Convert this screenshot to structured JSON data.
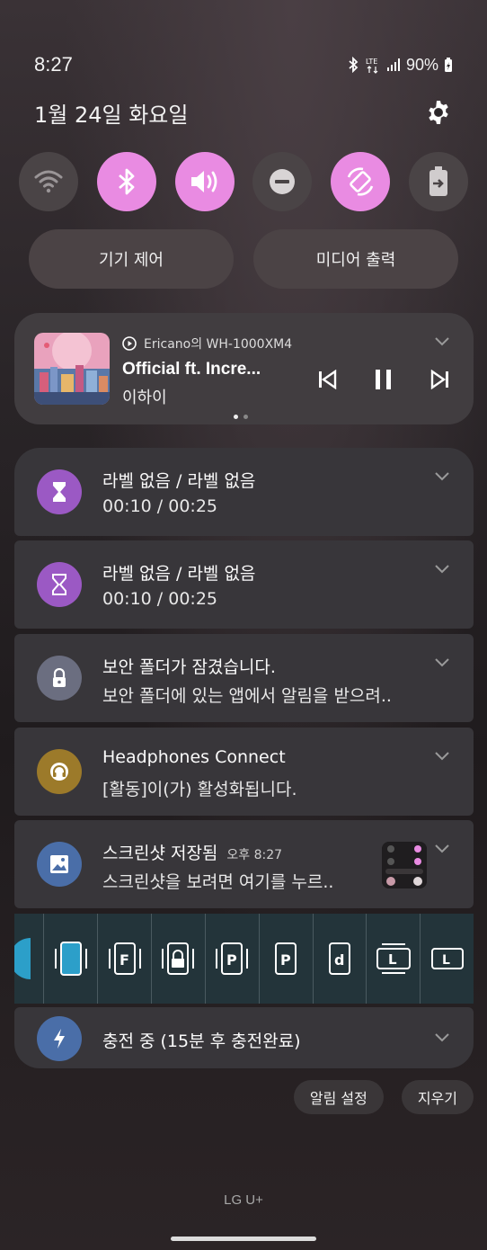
{
  "status_bar": {
    "time": "8:27",
    "network": "LTE",
    "battery": "90%"
  },
  "header": {
    "date": "1월 24일 화요일"
  },
  "quick_toggles": [
    {
      "name": "wifi",
      "on": false
    },
    {
      "name": "bluetooth",
      "on": true
    },
    {
      "name": "sound",
      "on": true
    },
    {
      "name": "do-not-disturb",
      "on": false
    },
    {
      "name": "auto-rotate",
      "on": true
    },
    {
      "name": "power-share",
      "on": false
    }
  ],
  "pills": {
    "device_control": "기기 제어",
    "media_output": "미디어 출력"
  },
  "media": {
    "source": "Ericano의 WH-1000XM4",
    "title": "Official ft. Incre...",
    "artist": "이하이"
  },
  "notifications": [
    {
      "title": "라벨 없음 / 라벨 없음",
      "sub": "00:10 / 00:25",
      "icon": "hourglass-icon",
      "color": "#9b59c4"
    },
    {
      "title": "라벨 없음 / 라벨 없음",
      "sub": "00:10 / 00:25",
      "icon": "hourglass-outline-icon",
      "color": "#9b59c4"
    },
    {
      "title": "보안 폴더가 잠겼습니다.",
      "sub": "보안 폴더에 있는 앱에서 알림을 받으려..",
      "icon": "lock-icon",
      "color": "#6b6e80"
    },
    {
      "title": "Headphones Connect",
      "sub": "[활동]이(가) 활성화됩니다.",
      "icon": "headphones-icon",
      "color": "#9c7a2a"
    },
    {
      "title": "스크린샷 저장됨",
      "time": "오후 8:27",
      "sub": "스크린샷을 보려면 여기를 누르..",
      "icon": "image-icon",
      "color": "#4a6ea8"
    }
  ],
  "charging": {
    "title": "충전 중 (15분 후 충전완료)",
    "color": "#4a6ea8"
  },
  "bottom": {
    "notification_settings": "알림 설정",
    "clear": "지우기"
  },
  "carrier": "LG U+",
  "strip_icons": [
    "partial",
    "phone-rotate",
    "F",
    "lock",
    "P-phone",
    "P",
    "d",
    "L-rotate",
    "L"
  ]
}
